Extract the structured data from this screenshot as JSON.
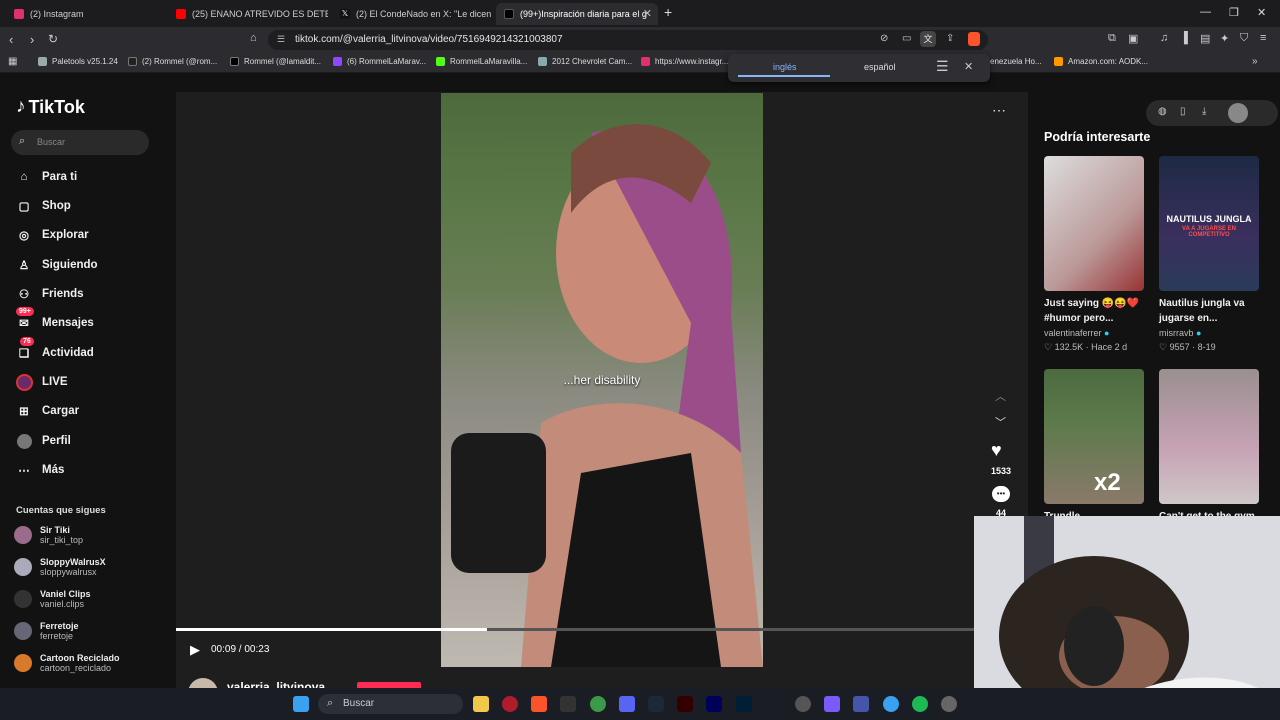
{
  "browser": {
    "tabs": [
      {
        "label": "(2) Instagram",
        "color": "#e1306c"
      },
      {
        "label": "(25) ENANO ATREVIDO ES DETENIDO",
        "color": "#ff0000"
      },
      {
        "label": "(2) El CondeNado en X: \"Le dicen Gal",
        "color": "#ffffff"
      },
      {
        "label": "(99+)Inspiración diaria para el g",
        "color": "#000000"
      }
    ],
    "url": "tiktok.com/@valerria_litvinova/video/7516949214321003807",
    "bookmarks": [
      "Paletools v25.1.24",
      "(2) Rommel (@rom...",
      "Rommel (@lamaldit...",
      "(6) RommelLaMarav...",
      "RommelLaMaravilla...",
      "2012 Chevrolet Cam...",
      "https://www.instagr...",
      "enezuela Ho...",
      "Amazon.com: AODK..."
    ],
    "translate": {
      "lang_from": "inglés",
      "lang_to": "español"
    }
  },
  "sidebar": {
    "logo": "TikTok",
    "search_placeholder": "Buscar",
    "nav": [
      {
        "label": "Para ti"
      },
      {
        "label": "Shop"
      },
      {
        "label": "Explorar"
      },
      {
        "label": "Siguiendo"
      },
      {
        "label": "Friends"
      },
      {
        "label": "Mensajes",
        "badge": "99+"
      },
      {
        "label": "Actividad",
        "badge": "76"
      },
      {
        "label": "LIVE"
      },
      {
        "label": "Cargar"
      },
      {
        "label": "Perfil"
      },
      {
        "label": "Más"
      }
    ],
    "following_title": "Cuentas que sigues",
    "following": [
      {
        "name": "Sir Tiki",
        "handle": "sir_tiki_top"
      },
      {
        "name": "SloppyWalrusX",
        "handle": "sloppywalrusx"
      },
      {
        "name": "Vaniel Clips",
        "handle": "vaniel.clips"
      },
      {
        "name": "Ferretoje",
        "handle": "ferretoje"
      },
      {
        "name": "Cartoon Reciclado",
        "handle": "cartoon_reciclado"
      }
    ]
  },
  "video": {
    "caption": "...her disability",
    "time": "00:09 / 00:23",
    "progress": 0.39,
    "likes": "1533",
    "comments": "44",
    "author": "valerria_litvinova"
  },
  "right": {
    "title": "Podría interesarte",
    "cards": [
      {
        "caption1": "Just saying 😝😝❤️",
        "caption2": "#humor pero...",
        "user": "valentinaferrer",
        "likes": "132.5K",
        "date": "Hace 2 d"
      },
      {
        "caption1": "Nautilus jungla va",
        "caption2": "jugarse en...",
        "user": "misrravb",
        "likes": "9557",
        "date": "8-19",
        "thumb_text1": "NAUTILUS JUNGLA",
        "thumb_text2": "VA A JUGARSE EN COMPETITIVO"
      },
      {
        "caption1": "Trundle",
        "caption2": "",
        "user": "",
        "likes": "",
        "date": "",
        "thumb_text1": "x2"
      },
      {
        "caption1": "Can't get to the gym",
        "caption2": "",
        "user": "",
        "likes": "",
        "date": ""
      }
    ]
  },
  "taskbar": {
    "search": "Buscar"
  }
}
